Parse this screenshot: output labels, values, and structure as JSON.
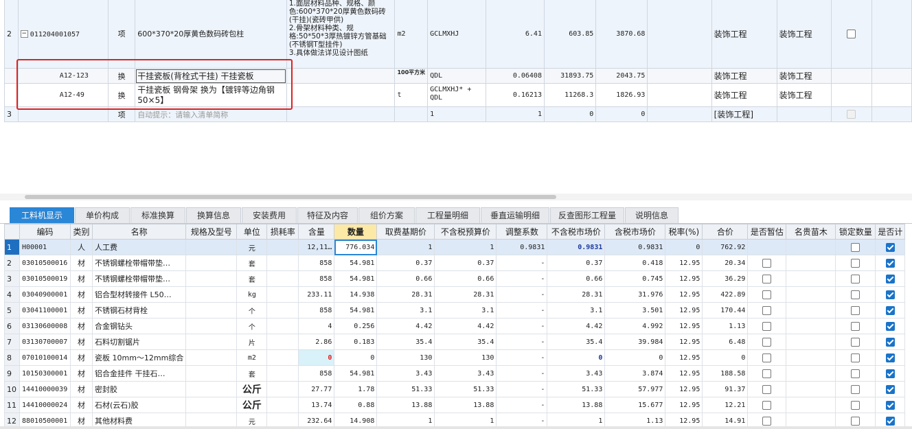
{
  "upper": {
    "rows": [
      {
        "num": "2",
        "tree": "−",
        "code": "011204001057",
        "type": "项",
        "name": "600*370*20厚黄色数码砖包柱",
        "feature": "1.面层材料品种、规格、颜色:600*370*20厚黄色数码砖(干挂)(瓷砖甲供)\n2.骨架材料种类、规格:50*50*3厚热镀锌方管基础(不锈钢T型挂件)\n3.具体做法详见设计图纸",
        "unit": "m2",
        "expr": "GCLMXHJ",
        "qty": "6.41",
        "price": "603.85",
        "total": "3870.68",
        "cat1": "装饰工程",
        "cat2": "装饰工程"
      },
      {
        "num": "",
        "code": "A12-123",
        "type": "换",
        "name": "干挂瓷板(背栓式干挂) 干挂瓷板",
        "unit": "100平方米",
        "expr": "QDL",
        "qty": "0.06408",
        "price": "31893.75",
        "total": "2043.75",
        "cat1": "装饰工程",
        "cat2": "装饰工程"
      },
      {
        "num": "",
        "code": "A12-49",
        "type": "换",
        "name": "干挂瓷板 钢骨架  换为【镀锌等边角钢 50×5】",
        "unit": "t",
        "expr": "GCLMXHJ* + QDL",
        "qty": "0.16213",
        "price": "11268.3",
        "total": "1826.93",
        "cat1": "装饰工程",
        "cat2": "装饰工程"
      },
      {
        "num": "3",
        "code": "",
        "type": "项",
        "name": "自动提示：请输入清单简称",
        "unit": "",
        "expr": "1",
        "qty": "1",
        "price": "0",
        "total": "0",
        "cat1": "[装饰工程]",
        "cat2": ""
      }
    ]
  },
  "tabs": [
    "工料机显示",
    "单价构成",
    "标准换算",
    "换算信息",
    "安装费用",
    "特征及内容",
    "组价方案",
    "工程量明细",
    "垂直运输明细",
    "反查图形工程量",
    "说明信息"
  ],
  "lower": {
    "headers": [
      "",
      "编码",
      "类别",
      "名称",
      "规格及型号",
      "单位",
      "损耗率",
      "含量",
      "数量",
      "取费基期价",
      "不含税预算价",
      "调整系数",
      "不含税市场价",
      "含税市场价",
      "税率(%)",
      "合价",
      "是否暂估",
      "名贵苗木",
      "锁定数量",
      "是否计"
    ],
    "rows": [
      [
        "1",
        "H00001",
        "人",
        "人工费",
        "",
        "元",
        "",
        "12,11…",
        "776.034",
        "1",
        "1",
        "0.9831",
        "0.9831",
        "0.9831",
        "0",
        "762.92",
        "",
        "",
        "",
        ""
      ],
      [
        "2",
        "03010500016",
        "材",
        "不锈钢螺栓带帽带垫…",
        "",
        "套",
        "",
        "858",
        "54.981",
        "0.37",
        "0.37",
        "-",
        "0.37",
        "0.418",
        "12.95",
        "20.34",
        "",
        "",
        "",
        ""
      ],
      [
        "3",
        "03010500019",
        "材",
        "不锈钢螺栓带帽带垫…",
        "",
        "套",
        "",
        "858",
        "54.981",
        "0.66",
        "0.66",
        "-",
        "0.66",
        "0.745",
        "12.95",
        "36.29",
        "",
        "",
        "",
        ""
      ],
      [
        "4",
        "03040900001",
        "材",
        "铝合型材转接件 L50…",
        "",
        "kg",
        "",
        "233.11",
        "14.938",
        "28.31",
        "28.31",
        "-",
        "28.31",
        "31.976",
        "12.95",
        "422.89",
        "",
        "",
        "",
        ""
      ],
      [
        "5",
        "03041100001",
        "材",
        "不锈钢石材背栓",
        "",
        "个",
        "",
        "858",
        "54.981",
        "3.1",
        "3.1",
        "-",
        "3.1",
        "3.501",
        "12.95",
        "170.44",
        "",
        "",
        "",
        ""
      ],
      [
        "6",
        "03130600008",
        "材",
        "合金钢钻头",
        "",
        "个",
        "",
        "4",
        "0.256",
        "4.42",
        "4.42",
        "-",
        "4.42",
        "4.992",
        "12.95",
        "1.13",
        "",
        "",
        "",
        ""
      ],
      [
        "7",
        "03130700007",
        "材",
        "石料切割锯片",
        "",
        "片",
        "",
        "2.86",
        "0.183",
        "35.4",
        "35.4",
        "-",
        "35.4",
        "39.984",
        "12.95",
        "6.48",
        "",
        "",
        "",
        ""
      ],
      [
        "8",
        "07010100014",
        "材",
        "瓷板 10mm～12mm综合",
        "",
        "m2",
        "",
        "0",
        "0",
        "130",
        "130",
        "-",
        "0",
        "0",
        "12.95",
        "0",
        "",
        "",
        "",
        ""
      ],
      [
        "9",
        "10150300001",
        "材",
        "铝合金挂件 干挂石…",
        "",
        "套",
        "",
        "858",
        "54.981",
        "3.43",
        "3.43",
        "-",
        "3.43",
        "3.874",
        "12.95",
        "188.58",
        "",
        "",
        "",
        ""
      ],
      [
        "10",
        "14410000039",
        "材",
        "密封胶",
        "",
        "公斤",
        "",
        "27.77",
        "1.78",
        "51.33",
        "51.33",
        "-",
        "51.33",
        "57.977",
        "12.95",
        "91.37",
        "",
        "",
        "",
        ""
      ],
      [
        "11",
        "14410000024",
        "材",
        "石材(云石)胶",
        "",
        "公斤",
        "",
        "13.74",
        "0.88",
        "13.88",
        "13.88",
        "-",
        "13.88",
        "15.677",
        "12.95",
        "12.21",
        "",
        "",
        "",
        ""
      ],
      [
        "12",
        "88010500001",
        "材",
        "其他材料费",
        "",
        "元",
        "",
        "232.64",
        "14.908",
        "1",
        "1",
        "-",
        "1",
        "1.13",
        "12.95",
        "14.91",
        "",
        "",
        "",
        ""
      ]
    ]
  },
  "colors": {
    "accent": "#2a86d6",
    "highlight": "#e02020"
  }
}
